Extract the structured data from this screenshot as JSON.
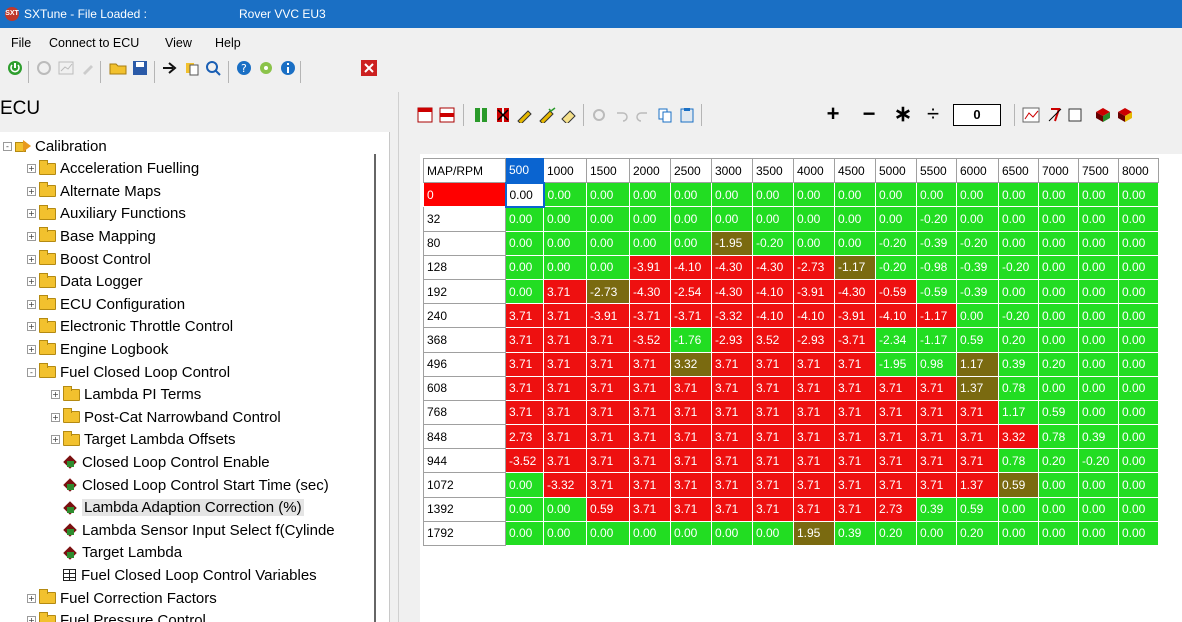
{
  "window": {
    "title": "SXTune - File Loaded :",
    "file": "Rover VVC EU3",
    "icon_text": "SXT"
  },
  "menu": [
    "File",
    "Connect to ECU",
    "View",
    "Help"
  ],
  "ecu_label": "ECU",
  "tree": [
    {
      "label": "Calibration",
      "depth": 0,
      "icon": "arrow",
      "exp": "-"
    },
    {
      "label": "Acceleration Fuelling",
      "depth": 1,
      "icon": "folder",
      "exp": "+"
    },
    {
      "label": "Alternate Maps",
      "depth": 1,
      "icon": "folder",
      "exp": "+"
    },
    {
      "label": "Auxiliary Functions",
      "depth": 1,
      "icon": "folder",
      "exp": "+"
    },
    {
      "label": "Base Mapping",
      "depth": 1,
      "icon": "folder",
      "exp": "+"
    },
    {
      "label": "Boost Control",
      "depth": 1,
      "icon": "folder",
      "exp": "+"
    },
    {
      "label": "Data Logger",
      "depth": 1,
      "icon": "folder",
      "exp": "+"
    },
    {
      "label": "ECU Configuration",
      "depth": 1,
      "icon": "folder",
      "exp": "+"
    },
    {
      "label": "Electronic Throttle Control",
      "depth": 1,
      "icon": "folder",
      "exp": "+"
    },
    {
      "label": "Engine Logbook",
      "depth": 1,
      "icon": "folder",
      "exp": "+"
    },
    {
      "label": "Fuel Closed Loop Control",
      "depth": 1,
      "icon": "folder",
      "exp": "-"
    },
    {
      "label": "Lambda PI Terms",
      "depth": 2,
      "icon": "folder",
      "exp": "+"
    },
    {
      "label": "Post-Cat Narrowband Control",
      "depth": 2,
      "icon": "folder",
      "exp": "+"
    },
    {
      "label": "Target Lambda Offsets",
      "depth": 2,
      "icon": "folder",
      "exp": "+"
    },
    {
      "label": "Closed Loop Control Enable",
      "depth": 2,
      "icon": "cube",
      "exp": ""
    },
    {
      "label": "Closed Loop Control Start Time (sec)",
      "depth": 2,
      "icon": "cube",
      "exp": ""
    },
    {
      "label": "Lambda Adaption Correction (%)",
      "depth": 2,
      "icon": "cube",
      "exp": "",
      "selected": true
    },
    {
      "label": "Lambda Sensor Input Select f(Cylinde",
      "depth": 2,
      "icon": "cube",
      "exp": ""
    },
    {
      "label": "Target Lambda",
      "depth": 2,
      "icon": "cube",
      "exp": ""
    },
    {
      "label": "Fuel Closed Loop Control Variables",
      "depth": 2,
      "icon": "grid",
      "exp": ""
    },
    {
      "label": "Fuel Correction Factors",
      "depth": 1,
      "icon": "folder",
      "exp": "+"
    },
    {
      "label": "Fuel Pressure Control",
      "depth": 1,
      "icon": "folder",
      "exp": "+"
    }
  ],
  "toolbar2": {
    "add": "+",
    "sub": "−",
    "mul": "∗",
    "div": "÷",
    "value": "0"
  },
  "table": {
    "corner": "MAP/RPM",
    "rpm": [
      "500",
      "1000",
      "1500",
      "2000",
      "2500",
      "3000",
      "3500",
      "4000",
      "4500",
      "5000",
      "5500",
      "6000",
      "6500",
      "7000",
      "7500",
      "8000"
    ],
    "map": [
      "0",
      "32",
      "80",
      "128",
      "192",
      "240",
      "368",
      "496",
      "608",
      "768",
      "848",
      "944",
      "1072",
      "1392",
      "1792"
    ],
    "values": [
      [
        "0.00",
        "0.00",
        "0.00",
        "0.00",
        "0.00",
        "0.00",
        "0.00",
        "0.00",
        "0.00",
        "0.00",
        "0.00",
        "0.00",
        "0.00",
        "0.00",
        "0.00",
        "0.00"
      ],
      [
        "0.00",
        "0.00",
        "0.00",
        "0.00",
        "0.00",
        "0.00",
        "0.00",
        "0.00",
        "0.00",
        "0.00",
        "-0.20",
        "0.00",
        "0.00",
        "0.00",
        "0.00",
        "0.00"
      ],
      [
        "0.00",
        "0.00",
        "0.00",
        "0.00",
        "0.00",
        "-1.95",
        "-0.20",
        "0.00",
        "0.00",
        "-0.20",
        "-0.39",
        "-0.20",
        "0.00",
        "0.00",
        "0.00",
        "0.00"
      ],
      [
        "0.00",
        "0.00",
        "0.00",
        "-3.91",
        "-4.10",
        "-4.30",
        "-4.30",
        "-2.73",
        "-1.17",
        "-0.20",
        "-0.98",
        "-0.39",
        "-0.20",
        "0.00",
        "0.00",
        "0.00"
      ],
      [
        "0.00",
        "3.71",
        "-2.73",
        "-4.30",
        "-2.54",
        "-4.30",
        "-4.10",
        "-3.91",
        "-4.30",
        "-0.59",
        "-0.59",
        "-0.39",
        "0.00",
        "0.00",
        "0.00",
        "0.00"
      ],
      [
        "3.71",
        "3.71",
        "-3.91",
        "-3.71",
        "-3.71",
        "-3.32",
        "-4.10",
        "-4.10",
        "-3.91",
        "-4.10",
        "-1.17",
        "0.00",
        "-0.20",
        "0.00",
        "0.00",
        "0.00"
      ],
      [
        "3.71",
        "3.71",
        "3.71",
        "-3.52",
        "-1.76",
        "-2.93",
        "3.52",
        "-2.93",
        "-3.71",
        "-2.34",
        "-1.17",
        "0.59",
        "0.20",
        "0.00",
        "0.00",
        "0.00"
      ],
      [
        "3.71",
        "3.71",
        "3.71",
        "3.71",
        "3.32",
        "3.71",
        "3.71",
        "3.71",
        "3.71",
        "-1.95",
        "0.98",
        "1.17",
        "0.39",
        "0.20",
        "0.00",
        "0.00"
      ],
      [
        "3.71",
        "3.71",
        "3.71",
        "3.71",
        "3.71",
        "3.71",
        "3.71",
        "3.71",
        "3.71",
        "3.71",
        "3.71",
        "1.37",
        "0.78",
        "0.00",
        "0.00",
        "0.00"
      ],
      [
        "3.71",
        "3.71",
        "3.71",
        "3.71",
        "3.71",
        "3.71",
        "3.71",
        "3.71",
        "3.71",
        "3.71",
        "3.71",
        "3.71",
        "1.17",
        "0.59",
        "0.00",
        "0.00"
      ],
      [
        "2.73",
        "3.71",
        "3.71",
        "3.71",
        "3.71",
        "3.71",
        "3.71",
        "3.71",
        "3.71",
        "3.71",
        "3.71",
        "3.71",
        "3.32",
        "0.78",
        "0.39",
        "0.00"
      ],
      [
        "-3.52",
        "3.71",
        "3.71",
        "3.71",
        "3.71",
        "3.71",
        "3.71",
        "3.71",
        "3.71",
        "3.71",
        "3.71",
        "3.71",
        "0.78",
        "0.20",
        "-0.20",
        "0.00"
      ],
      [
        "0.00",
        "-3.32",
        "3.71",
        "3.71",
        "3.71",
        "3.71",
        "3.71",
        "3.71",
        "3.71",
        "3.71",
        "3.71",
        "1.37",
        "0.59",
        "0.00",
        "0.00",
        "0.00"
      ],
      [
        "0.00",
        "0.00",
        "0.59",
        "3.71",
        "3.71",
        "3.71",
        "3.71",
        "3.71",
        "3.71",
        "2.73",
        "0.39",
        "0.59",
        "0.00",
        "0.00",
        "0.00",
        "0.00"
      ],
      [
        "0.00",
        "0.00",
        "0.00",
        "0.00",
        "0.00",
        "0.00",
        "0.00",
        "1.95",
        "0.39",
        "0.20",
        "0.00",
        "0.20",
        "0.00",
        "0.00",
        "0.00",
        "0.00"
      ]
    ],
    "colors": [
      "gggggggggggggggg",
      "gggggggggggggggg",
      "gggggogggggggggg",
      "gggrrrrrogggggggg",
      "grorrrrrrrggggggg",
      "rrrrrrrrrrrgggggg",
      "rrrrgrrrrgggggggg",
      "rrrrorrrrggoggggg",
      "rrrrrrrrrrrogggg",
      "rrrrrrrrrrrrgggg",
      "rrrrrrrrrrrrrggg",
      "rrrrrrrrrrrrgggg",
      "grrrrrrrrrrrogggg",
      "ggrrrrrrrrgggggg",
      "gggggggogggggggg"
    ]
  },
  "colors": {
    "titlebar": "#1a6fc4",
    "cell_green": "#22dd22",
    "cell_red": "#ee1010",
    "cell_olive": "#7a6a10",
    "selection": "#0a64d0"
  }
}
